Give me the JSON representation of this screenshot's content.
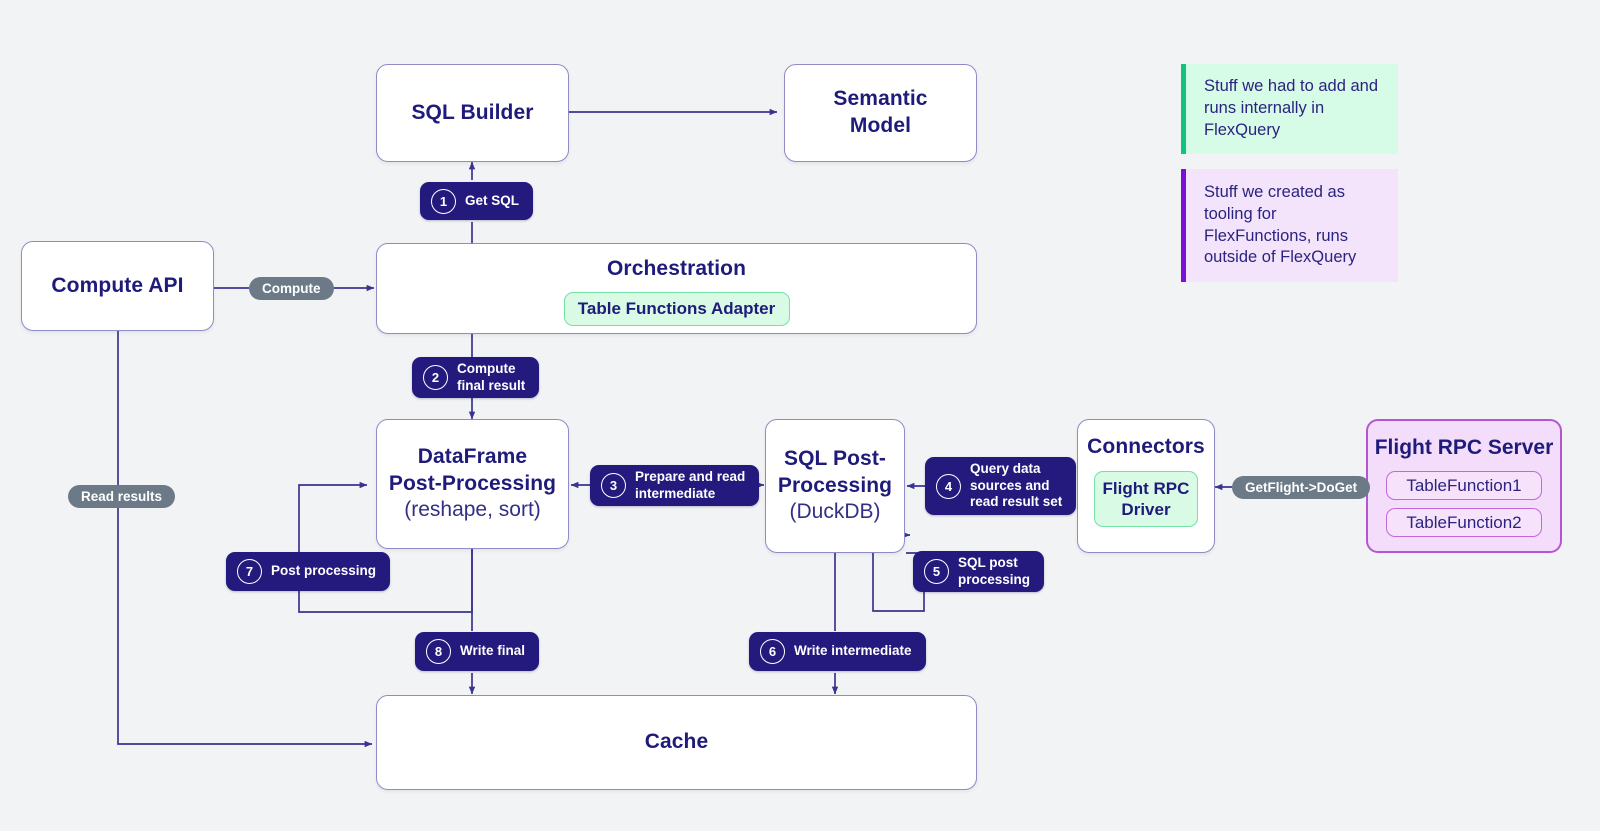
{
  "diagram": {
    "title": "FlexQuery table functions architecture flow",
    "colors": {
      "background": "#f2f3f5",
      "node_border": "#8f8bc4",
      "ink": "#1e1b7a",
      "badge_navy": "#241a7e",
      "pill_grey": "#6b7a86",
      "mint_fill": "#d9fbe6",
      "mint_border": "#74e0a4",
      "mint_accent": "#0fc47d",
      "violet_fill": "#f4ddfa",
      "violet_border": "#b455d2",
      "violet_accent": "#7a0fd6",
      "wire": "#3a3391"
    }
  },
  "nodes": {
    "sql_builder": {
      "title": "SQL Builder"
    },
    "semantic_model": {
      "title": "Semantic\nModel"
    },
    "orchestration": {
      "title": "Orchestration",
      "chip": "Table Functions Adapter"
    },
    "compute_api": {
      "title": "Compute API"
    },
    "dataframe_post": {
      "title": "DataFrame\nPost-Processing",
      "subtitle": "(reshape, sort)"
    },
    "sql_post": {
      "title": "SQL Post-\nProcessing",
      "subtitle": "(DuckDB)"
    },
    "connectors": {
      "title": "Connectors",
      "chip": "Flight RPC\nDriver"
    },
    "flight_rpc_server": {
      "title": "Flight RPC Server",
      "functions": [
        "TableFunction1",
        "TableFunction2"
      ]
    },
    "cache": {
      "title": "Cache"
    }
  },
  "steps": [
    {
      "num": "1",
      "label": "Get SQL"
    },
    {
      "num": "2",
      "label": "Compute\nfinal result"
    },
    {
      "num": "3",
      "label": "Prepare and read\nintermediate"
    },
    {
      "num": "4",
      "label": "Query data\nsources and\nread result set"
    },
    {
      "num": "5",
      "label": "SQL post\nprocessing"
    },
    {
      "num": "6",
      "label": "Write intermediate"
    },
    {
      "num": "7",
      "label": "Post processing"
    },
    {
      "num": "8",
      "label": "Write final"
    }
  ],
  "edge_labels": {
    "compute": "Compute",
    "read_results": "Read results",
    "get_flight": "GetFlight->DoGet"
  },
  "legend": [
    {
      "text": "Stuff we had to add and runs internally in FlexQuery"
    },
    {
      "text": "Stuff we created as tooling for FlexFunctions, runs outside of FlexQuery"
    }
  ]
}
